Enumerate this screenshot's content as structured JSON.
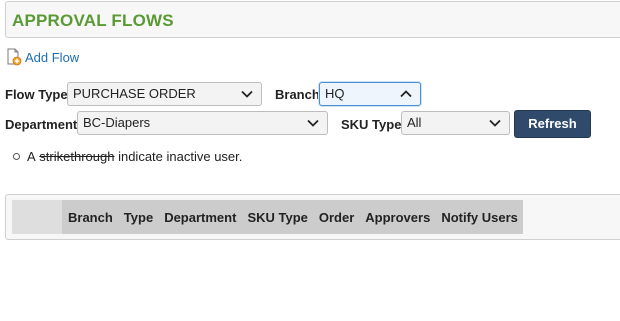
{
  "page": {
    "title": "APPROVAL FLOWS"
  },
  "actions": {
    "add_flow_label": "Add Flow",
    "add_flow_icon": "add-document-icon",
    "refresh_label": "Refresh"
  },
  "filters": {
    "flow_type": {
      "label": "Flow Type",
      "value": "PURCHASE ORDER"
    },
    "branch": {
      "label": "Branch",
      "value": "HQ",
      "expanded": true
    },
    "department": {
      "label": "Department",
      "value": "BC-Diapers"
    },
    "sku_type": {
      "label": "SKU Type",
      "value": "All"
    }
  },
  "note": {
    "prefix": "A",
    "strike_word": "strikethrough",
    "suffix": "indicate inactive user."
  },
  "table": {
    "columns": [
      "Branch",
      "Type",
      "Department",
      "SKU Type",
      "Order",
      "Approvers",
      "Notify Users"
    ],
    "rows": []
  },
  "colors": {
    "title": "#5a9a35",
    "link": "#1f6fb5",
    "button_bg": "#2f4a6b",
    "header_bg": "#cccccc",
    "focus_border": "#4a8fd6"
  }
}
